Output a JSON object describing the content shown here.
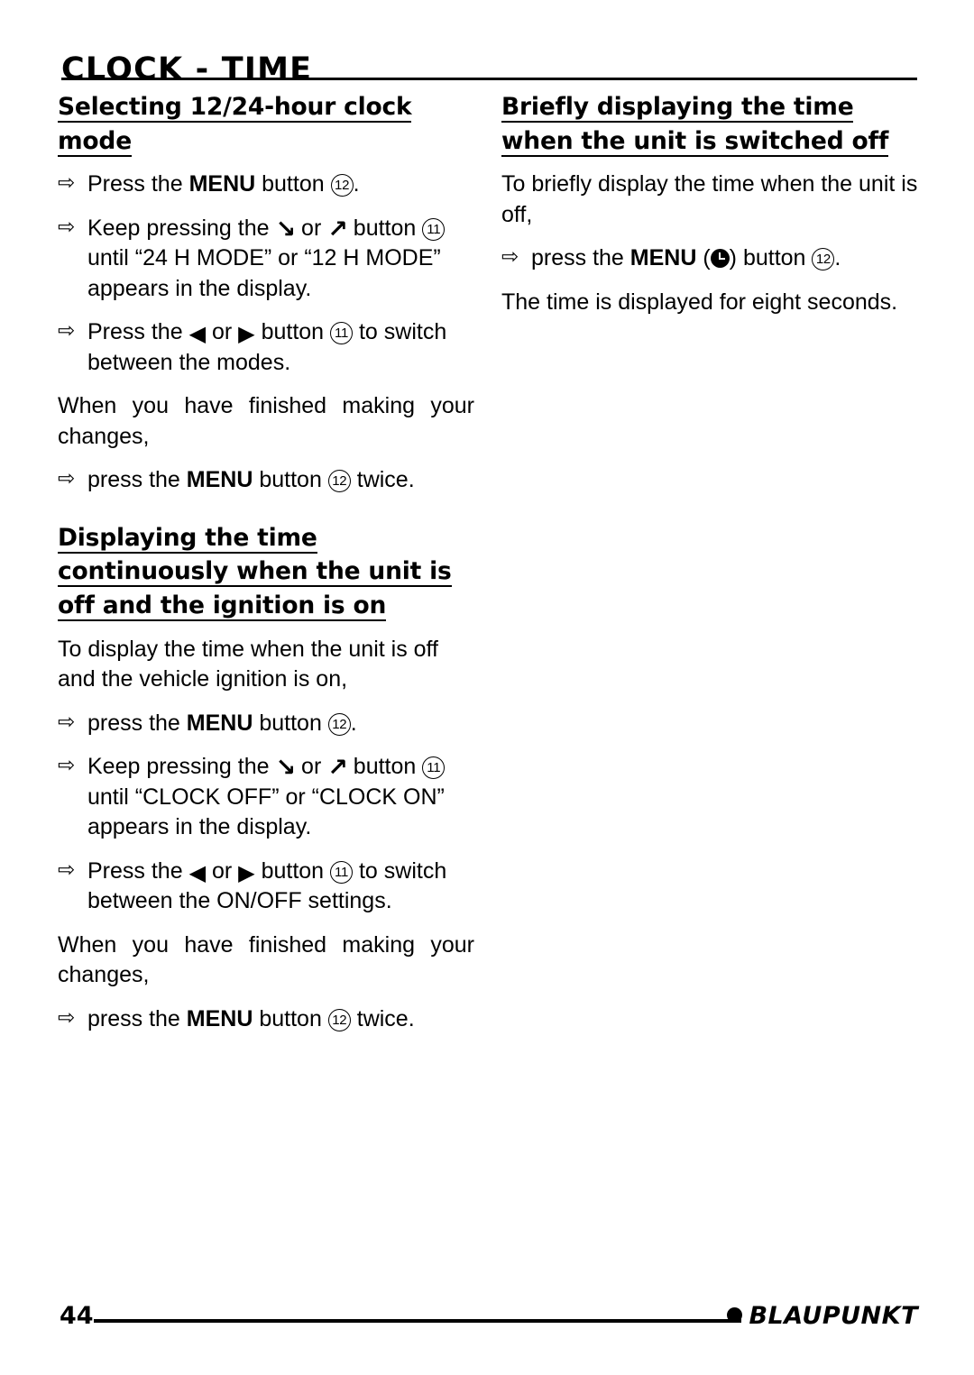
{
  "header": {
    "title": "CLOCK - TIME"
  },
  "left_column": {
    "section1": {
      "heading": "Selecting 12/24-hour clock mode",
      "step1_pre": "Press the ",
      "step1_menu": "MENU",
      "step1_mid": " button ",
      "step1_num": "12",
      "step1_post": ".",
      "step2_pre": "Keep pressing the ",
      "step2_or": " or ",
      "step2_mid": " button ",
      "step2_num": "11",
      "step2_post": " until “24 H MODE” or “12 H MODE” appears in the display.",
      "step3_pre": "Press the ",
      "step3_or": " or ",
      "step3_mid": " button ",
      "step3_num": "11",
      "step3_post": " to switch between the modes.",
      "para1": "When you have finished making your changes,",
      "step4_pre": "press the ",
      "step4_menu": "MENU",
      "step4_mid": " button ",
      "step4_num": "12",
      "step4_post": " twice."
    },
    "section2": {
      "heading": "Displaying the time continuously when the unit is off and the ignition is on",
      "para1": "To display the time when the unit is off and the vehicle ignition is on,",
      "step1_pre": "press the ",
      "step1_menu": "MENU",
      "step1_mid": " button ",
      "step1_num": "12",
      "step1_post": ".",
      "step2_pre": "Keep pressing the ",
      "step2_or": " or ",
      "step2_mid": " button ",
      "step2_num": "11",
      "step2_post": " until “CLOCK OFF” or “CLOCK ON” appears in the display.",
      "step3_pre": "Press the ",
      "step3_or": " or ",
      "step3_mid": " button ",
      "step3_num": "11",
      "step3_post": " to switch between the ON/OFF settings.",
      "para2": "When you have finished making your changes,",
      "step4_pre": "press the ",
      "step4_menu": "MENU",
      "step4_mid": " button ",
      "step4_num": "12",
      "step4_post": " twice."
    }
  },
  "right_column": {
    "section1": {
      "heading": "Briefly displaying the time when the unit is switched off",
      "para1": "To briefly display the time when the unit is off,",
      "step1_pre": "press the ",
      "step1_menu": "MENU",
      "step1_paren_open": " (",
      "step1_paren_close": ") button ",
      "step1_num": "12",
      "step1_post": ".",
      "para2": "The time is displayed for eight seconds."
    }
  },
  "footer": {
    "page_number": "44",
    "brand": "BLAUPUNKT"
  },
  "icons": {
    "seek_down": "↘",
    "seek_up": "↗",
    "left": "◀",
    "right": "▶",
    "arrow_bullet": "⇨"
  }
}
